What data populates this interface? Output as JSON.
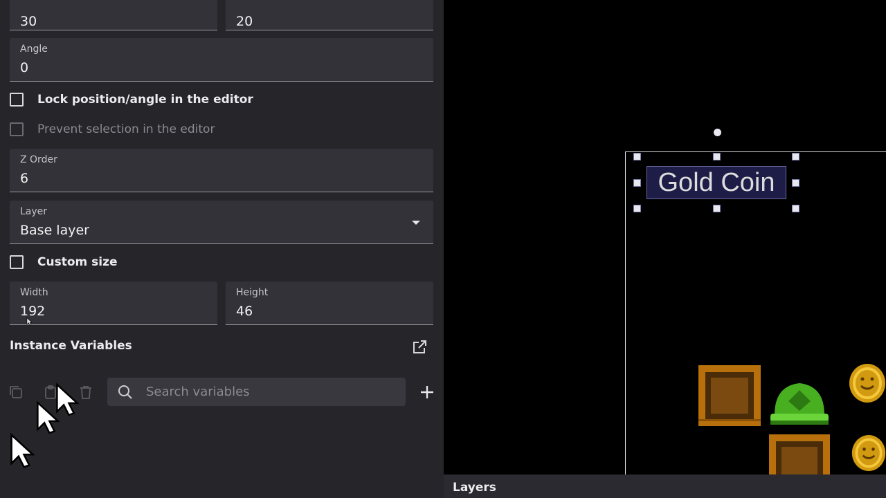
{
  "properties": {
    "x": {
      "value": "30"
    },
    "y": {
      "value": "20"
    },
    "angle": {
      "label": "Angle",
      "value": "0"
    },
    "lock_position": {
      "label": "Lock position/angle in the editor"
    },
    "prevent_selection": {
      "label": "Prevent selection in the editor"
    },
    "z_order": {
      "label": "Z Order",
      "value": "6"
    },
    "layer": {
      "label": "Layer",
      "value": "Base layer"
    },
    "custom_size": {
      "label": "Custom size"
    },
    "width": {
      "label": "Width",
      "value": "192"
    },
    "height": {
      "label": "Height",
      "value": "46"
    }
  },
  "instance_variables": {
    "title": "Instance Variables",
    "search_placeholder": "Search variables"
  },
  "canvas": {
    "selected_text": "Gold Coin"
  },
  "layers_panel": {
    "title": "Layers"
  },
  "icons": [
    "copy-icon",
    "paste-icon",
    "delete-icon",
    "search-icon",
    "add-icon",
    "open-external-icon",
    "dropdown-arrow-icon",
    "mouse-cursor-icon"
  ],
  "colors": {
    "panel_bg": "#25252a",
    "field_bg": "#323238",
    "canvas_bg": "#000000",
    "text_object_bg": "#1e1d48"
  }
}
